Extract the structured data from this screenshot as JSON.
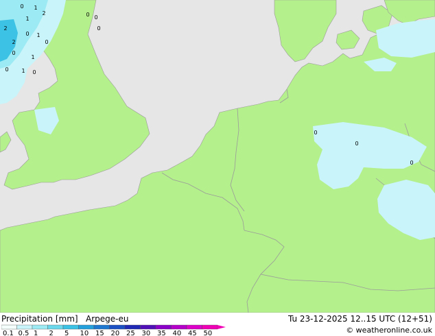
{
  "header": {
    "product": "Precipitation [mm]",
    "model": "Arpege-eu",
    "valid_time": "Tu 23-12-2025 12..15 UTC (12+51)"
  },
  "credit": "© weatheronline.co.uk",
  "legend": {
    "labels": [
      "0.1",
      "0.5",
      "1",
      "2",
      "5",
      "10",
      "15",
      "20",
      "25",
      "30",
      "35",
      "40",
      "45",
      "50"
    ],
    "colors": [
      "#f5fffb",
      "#c8f4fa",
      "#9ceaf3",
      "#6cd8ec",
      "#3cc2e4",
      "#24a0dc",
      "#1e78d0",
      "#1a50c4",
      "#1e28b4",
      "#5010b8",
      "#8a00c8",
      "#b400c8",
      "#dc00c8",
      "#f000b4"
    ]
  },
  "colors": {
    "land": "#b4f08c",
    "sea": "#e6e6e6",
    "border": "#9a9a9a",
    "precip_light": "#c8f4fa",
    "precip_moderate": "#9ceaf3",
    "precip_heavy": "#3cc2e4"
  },
  "precip_values": [
    "0",
    "1",
    "2",
    "0",
    "0",
    "0",
    "1",
    "2",
    "0",
    "2",
    "1",
    "0",
    "0",
    "1",
    "0",
    "1",
    "0",
    "0",
    "0",
    "0"
  ]
}
